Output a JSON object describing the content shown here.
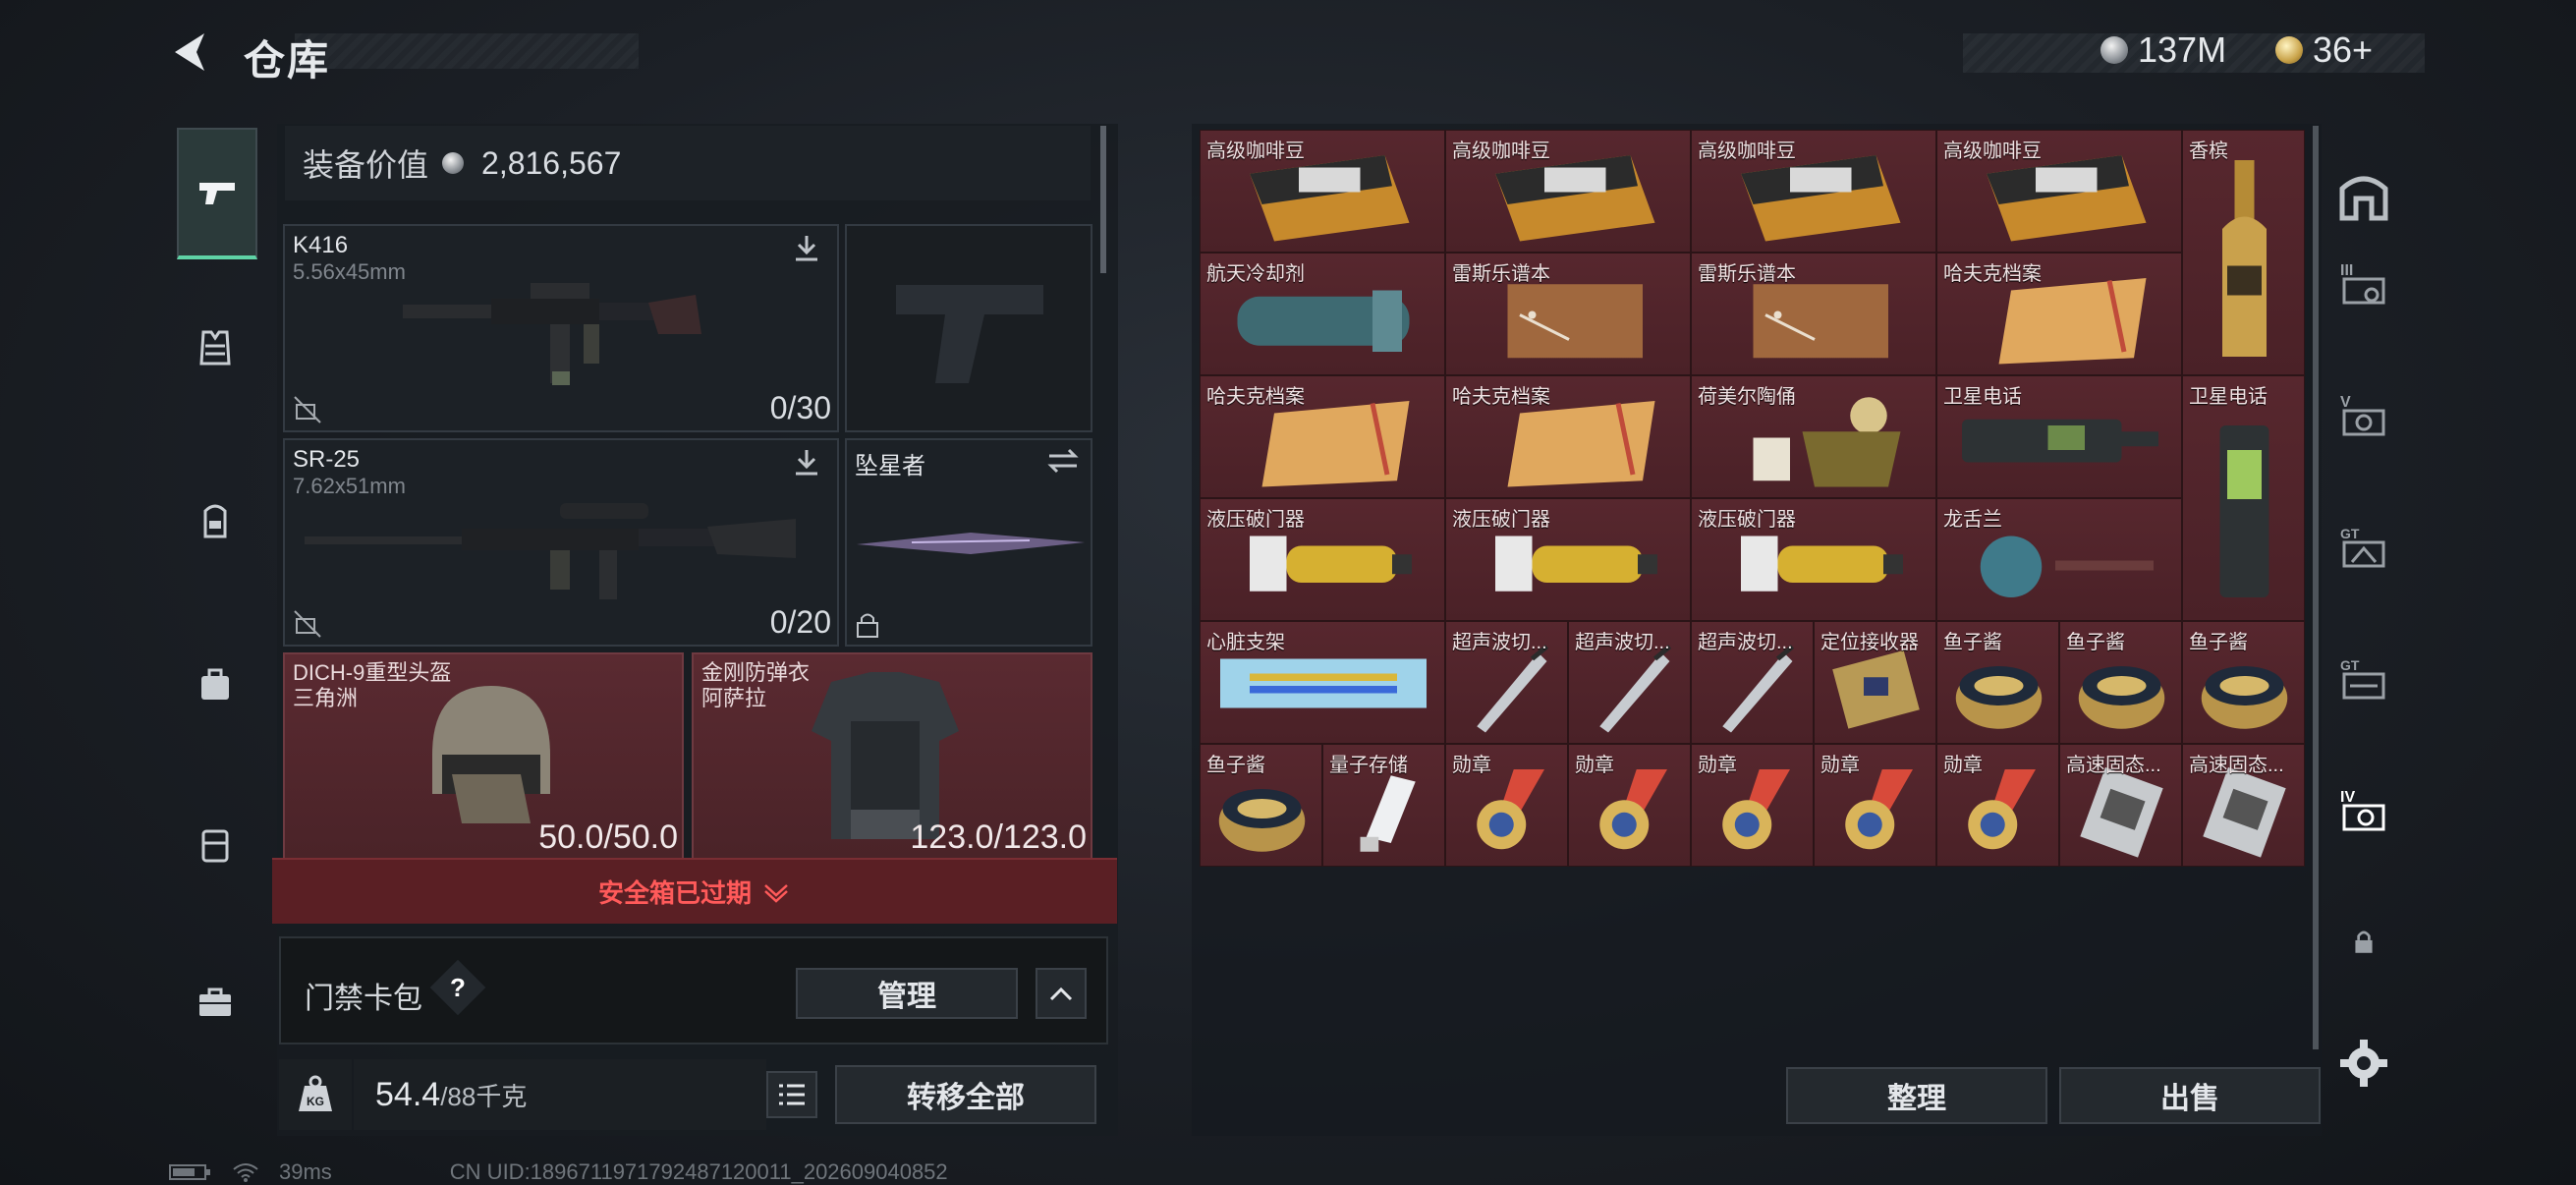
{
  "header": {
    "title": "仓库",
    "currency_silver": "137M",
    "currency_gold": "36+"
  },
  "left_nav": {
    "items": [
      "weapon-icon",
      "vest-icon",
      "backpack-icon",
      "bag-icon",
      "pouch-icon",
      "case-icon"
    ]
  },
  "loadout": {
    "value_label": "装备价值",
    "value": "2,816,567",
    "primary": {
      "name": "K416",
      "caliber": "5.56x45mm",
      "ammo": "0/30"
    },
    "secondary": {
      "name": "SR-25",
      "caliber": "7.62x51mm",
      "ammo": "0/20"
    },
    "melee": {
      "name": "坠星者"
    },
    "helmet": {
      "name": "DICH-9重型头盔",
      "sub": "三角洲",
      "durability": "50.0/50.0"
    },
    "armor": {
      "name": "金刚防弹衣",
      "sub": "阿萨拉",
      "durability": "123.0/123.0"
    },
    "safebox_status": "安全箱已过期",
    "keycard_label": "门禁卡包",
    "keycard_help": "?",
    "keycard_manage": "管理",
    "weight_current": "54.4",
    "weight_max": "/88千克",
    "weight_icon": "KG",
    "transfer_all": "转移全部"
  },
  "inventory": {
    "items": [
      {
        "label": "高级咖啡豆",
        "icon": "coffee-bag"
      },
      {
        "label": "高级咖啡豆",
        "icon": "coffee-bag"
      },
      {
        "label": "高级咖啡豆",
        "icon": "coffee-bag"
      },
      {
        "label": "高级咖啡豆",
        "icon": "coffee-bag"
      },
      {
        "label": "香槟",
        "icon": "champagne"
      },
      {
        "label": "航天冷却剂",
        "icon": "coolant"
      },
      {
        "label": "雷斯乐谱本",
        "icon": "notebook"
      },
      {
        "label": "雷斯乐谱本",
        "icon": "notebook"
      },
      {
        "label": "哈夫克档案",
        "icon": "folder"
      },
      {
        "label": "哈夫克档案",
        "icon": "folder"
      },
      {
        "label": "哈夫克档案",
        "icon": "folder"
      },
      {
        "label": "荷美尔陶俑",
        "icon": "figurine"
      },
      {
        "label": "卫星电话",
        "icon": "sat-phone"
      },
      {
        "label": "卫星电话",
        "icon": "sat-phone-tall"
      },
      {
        "label": "液压破门器",
        "icon": "breacher"
      },
      {
        "label": "液压破门器",
        "icon": "breacher"
      },
      {
        "label": "液压破门器",
        "icon": "breacher"
      },
      {
        "label": "龙舌兰",
        "icon": "bottle"
      },
      {
        "label": "心脏支架",
        "icon": "stent"
      },
      {
        "label": "超声波切...",
        "icon": "scalpel"
      },
      {
        "label": "超声波切...",
        "icon": "scalpel"
      },
      {
        "label": "超声波切...",
        "icon": "scalpel"
      },
      {
        "label": "定位接收器",
        "icon": "receiver"
      },
      {
        "label": "鱼子酱",
        "icon": "caviar"
      },
      {
        "label": "鱼子酱",
        "icon": "caviar"
      },
      {
        "label": "鱼子酱",
        "icon": "caviar"
      },
      {
        "label": "鱼子酱",
        "icon": "caviar"
      },
      {
        "label": "量子存储",
        "icon": "usb"
      },
      {
        "label": "勋章",
        "icon": "medal"
      },
      {
        "label": "勋章",
        "icon": "medal"
      },
      {
        "label": "勋章",
        "icon": "medal"
      },
      {
        "label": "勋章",
        "icon": "medal"
      },
      {
        "label": "勋章",
        "icon": "medal"
      },
      {
        "label": "高速固态...",
        "icon": "ssd"
      },
      {
        "label": "高速固态...",
        "icon": "ssd"
      }
    ],
    "organize": "整理",
    "sell": "出售"
  },
  "right_nav": {
    "items": [
      "home-tab-icon",
      "storage-III-icon",
      "storage-V-icon",
      "storage-GT1-icon",
      "storage-GT2-icon",
      "storage-IV-icon",
      "lock-icon",
      "settings-icon"
    ]
  },
  "status_bar": {
    "ping": "39ms",
    "uid": "CN UID:1896711971792487120011_202609040852"
  }
}
